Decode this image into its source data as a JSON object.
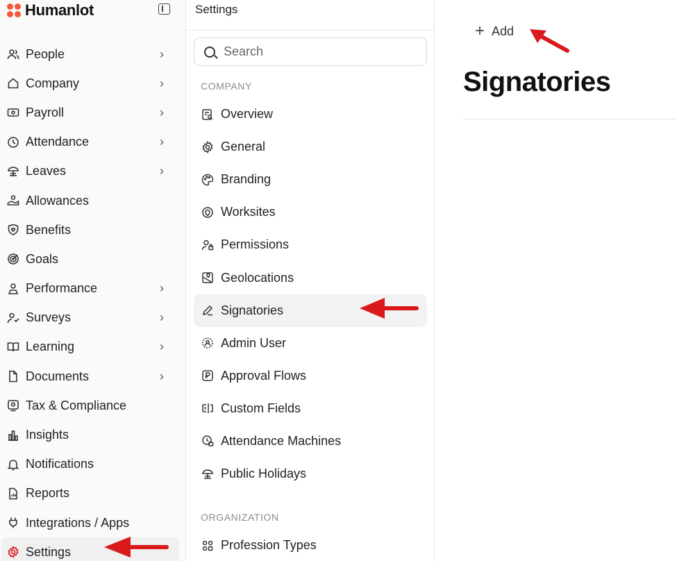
{
  "brand": {
    "name": "Humanlot",
    "color": "#f25c3b"
  },
  "sidebar": {
    "items": [
      {
        "label": "People",
        "icon": "users-icon",
        "chevron": true
      },
      {
        "label": "Company",
        "icon": "home-icon",
        "chevron": true
      },
      {
        "label": "Payroll",
        "icon": "banknote-icon",
        "chevron": true
      },
      {
        "label": "Attendance",
        "icon": "clock-icon",
        "chevron": true
      },
      {
        "label": "Leaves",
        "icon": "umbrella-icon",
        "chevron": true
      },
      {
        "label": "Allowances",
        "icon": "hand-coins-icon",
        "chevron": false
      },
      {
        "label": "Benefits",
        "icon": "heart-shield-icon",
        "chevron": false
      },
      {
        "label": "Goals",
        "icon": "target-icon",
        "chevron": false
      },
      {
        "label": "Performance",
        "icon": "performance-icon",
        "chevron": true
      },
      {
        "label": "Surveys",
        "icon": "survey-icon",
        "chevron": true
      },
      {
        "label": "Learning",
        "icon": "book-icon",
        "chevron": true
      },
      {
        "label": "Documents",
        "icon": "file-icon",
        "chevron": true
      },
      {
        "label": "Tax & Compliance",
        "icon": "tax-icon",
        "chevron": false
      },
      {
        "label": "Insights",
        "icon": "bar-chart-icon",
        "chevron": false
      },
      {
        "label": "Notifications",
        "icon": "bell-icon",
        "chevron": false
      },
      {
        "label": "Reports",
        "icon": "report-icon",
        "chevron": false
      },
      {
        "label": "Integrations / Apps",
        "icon": "plug-icon",
        "chevron": false
      },
      {
        "label": "Settings",
        "icon": "gear-icon",
        "chevron": false,
        "active": true
      }
    ]
  },
  "settings_panel": {
    "title": "Settings",
    "search_placeholder": "Search",
    "company_section": "COMPANY",
    "company_items": [
      {
        "label": "Overview",
        "icon": "overview-icon"
      },
      {
        "label": "General",
        "icon": "cog-icon"
      },
      {
        "label": "Branding",
        "icon": "palette-icon"
      },
      {
        "label": "Worksites",
        "icon": "map-pin-icon"
      },
      {
        "label": "Permissions",
        "icon": "user-lock-icon"
      },
      {
        "label": "Geolocations",
        "icon": "map-icon"
      },
      {
        "label": "Signatories",
        "icon": "pen-icon",
        "active": true
      },
      {
        "label": "Admin User",
        "icon": "admin-user-icon"
      },
      {
        "label": "Approval Flows",
        "icon": "approval-icon"
      },
      {
        "label": "Custom Fields",
        "icon": "text-field-icon"
      },
      {
        "label": "Attendance Machines",
        "icon": "machine-icon"
      },
      {
        "label": "Public Holidays",
        "icon": "holiday-icon"
      }
    ],
    "organization_section": "ORGANIZATION",
    "organization_items": [
      {
        "label": "Profession Types",
        "icon": "profession-icon"
      }
    ]
  },
  "main": {
    "add_label": "Add",
    "title": "Signatories"
  },
  "annotation_color": "#d9191c"
}
